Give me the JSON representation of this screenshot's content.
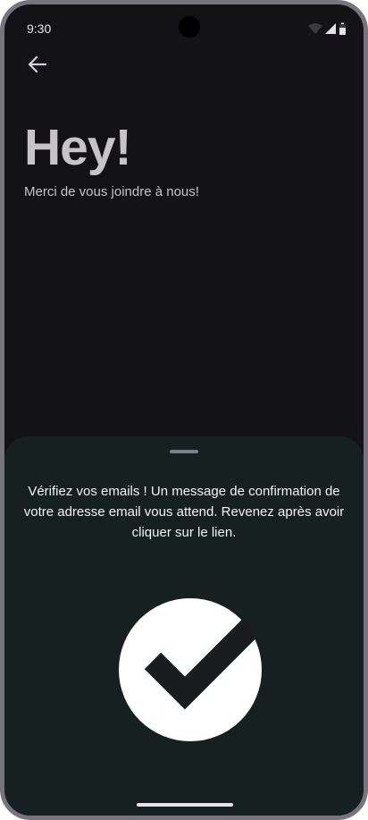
{
  "status_bar": {
    "time": "9:30",
    "icons": [
      "wifi-icon",
      "signal-icon",
      "battery-icon"
    ]
  },
  "header": {
    "back_icon": "arrow-back-icon"
  },
  "main": {
    "title": "Hey!",
    "subtitle": "Merci de vous joindre à nous!"
  },
  "bottom_sheet": {
    "message": "Vérifiez vos emails ! Un message de confirmation de votre adresse email vous attend. Revenez après avoir cliquer sur le lien.",
    "icon": "check-circle-icon"
  },
  "colors": {
    "background": "#131217",
    "sheet": "#172020",
    "title_text": "#c6c3c9",
    "sheet_text": "#f3f5f4"
  }
}
